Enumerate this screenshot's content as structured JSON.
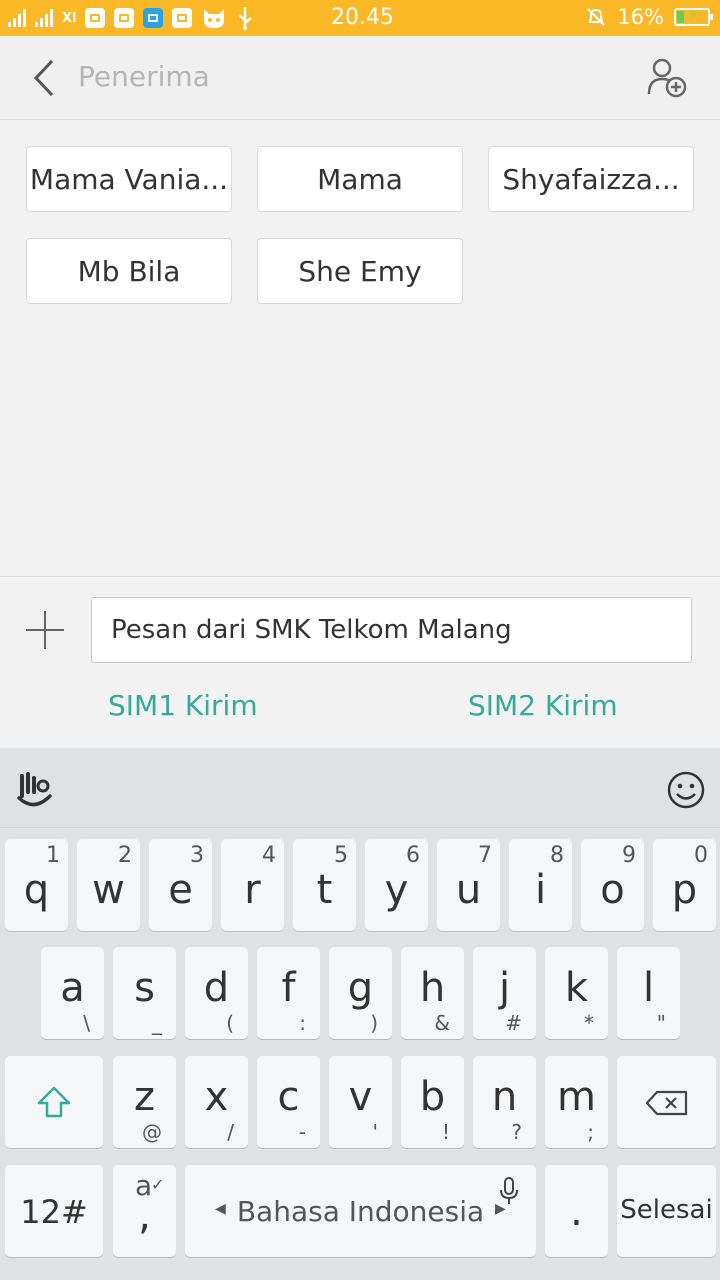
{
  "status_bar": {
    "carrier_label": "Xl",
    "time": "20.45",
    "battery_percent": "16%",
    "battery_level": 0.16
  },
  "header": {
    "title": "Penerima"
  },
  "recipients": [
    "Mama Vania...",
    "Mama",
    "Shyafaizza...",
    "Mb Bila",
    "She Emy"
  ],
  "compose": {
    "message": "Pesan dari SMK Telkom Malang",
    "sim1_label": "SIM1 Kirim",
    "sim2_label": "SIM2 Kirim",
    "accent_color": "#35a99a"
  },
  "keyboard": {
    "row1": [
      {
        "main": "q",
        "alt": "1"
      },
      {
        "main": "w",
        "alt": "2"
      },
      {
        "main": "e",
        "alt": "3"
      },
      {
        "main": "r",
        "alt": "4"
      },
      {
        "main": "t",
        "alt": "5"
      },
      {
        "main": "y",
        "alt": "6"
      },
      {
        "main": "u",
        "alt": "7"
      },
      {
        "main": "i",
        "alt": "8"
      },
      {
        "main": "o",
        "alt": "9"
      },
      {
        "main": "p",
        "alt": "0"
      }
    ],
    "row2": [
      {
        "main": "a",
        "alt": "\\"
      },
      {
        "main": "s",
        "alt": "_"
      },
      {
        "main": "d",
        "alt": "("
      },
      {
        "main": "f",
        "alt": ":"
      },
      {
        "main": "g",
        "alt": ")"
      },
      {
        "main": "h",
        "alt": "&"
      },
      {
        "main": "j",
        "alt": "#"
      },
      {
        "main": "k",
        "alt": "*"
      },
      {
        "main": "l",
        "alt": "\""
      }
    ],
    "row3": [
      {
        "main": "z",
        "alt": "@"
      },
      {
        "main": "x",
        "alt": "/"
      },
      {
        "main": "c",
        "alt": "-"
      },
      {
        "main": "v",
        "alt": "'"
      },
      {
        "main": "b",
        "alt": "!"
      },
      {
        "main": "n",
        "alt": "?"
      },
      {
        "main": "m",
        "alt": ";"
      }
    ],
    "symbols_label": "12#",
    "comma_main": ",",
    "comma_alt": "a",
    "space_label": "Bahasa Indonesia",
    "period_label": ".",
    "done_label": "Selesai"
  }
}
